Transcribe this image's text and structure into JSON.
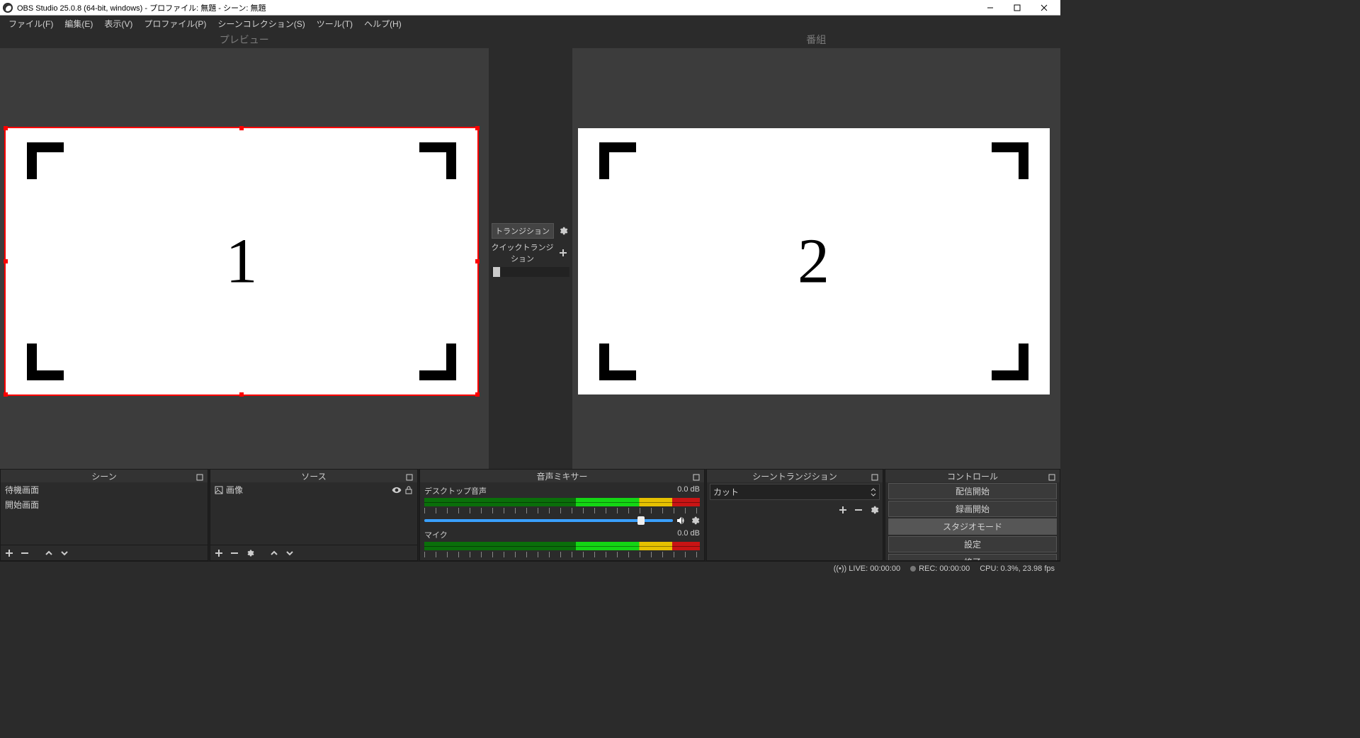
{
  "window": {
    "title": "OBS Studio 25.0.8 (64-bit, windows) - プロファイル: 無題 - シーン: 無題"
  },
  "menu": {
    "file": "ファイル(F)",
    "edit": "編集(E)",
    "view": "表示(V)",
    "profile": "プロファイル(P)",
    "scenecol": "シーンコレクション(S)",
    "tools": "ツール(T)",
    "help": "ヘルプ(H)"
  },
  "preview": {
    "left_label": "プレビュー",
    "right_label": "番組",
    "left_num": "1",
    "right_num": "2"
  },
  "transition": {
    "button": "トランジション",
    "quick": "クイックトランジション"
  },
  "docks": {
    "scenes": {
      "title": "シーン",
      "items": [
        "待機画面",
        "開始画面"
      ]
    },
    "sources": {
      "title": "ソース",
      "items": [
        {
          "name": "画像"
        }
      ]
    },
    "mixer": {
      "title": "音声ミキサー",
      "channels": [
        {
          "name": "デスクトップ音声",
          "db": "0.0 dB",
          "muted": false
        },
        {
          "name": "マイク",
          "db": "0.0 dB",
          "muted": true
        }
      ]
    },
    "scene_trans": {
      "title": "シーントランジション",
      "selected": "カット"
    },
    "controls": {
      "title": "コントロール",
      "buttons": {
        "stream": "配信開始",
        "record": "録画開始",
        "studio": "スタジオモード",
        "settings": "設定",
        "exit": "終了"
      }
    }
  },
  "status": {
    "live": "LIVE: 00:00:00",
    "rec": "REC: 00:00:00",
    "cpu": "CPU: 0.3%, 23.98 fps"
  }
}
